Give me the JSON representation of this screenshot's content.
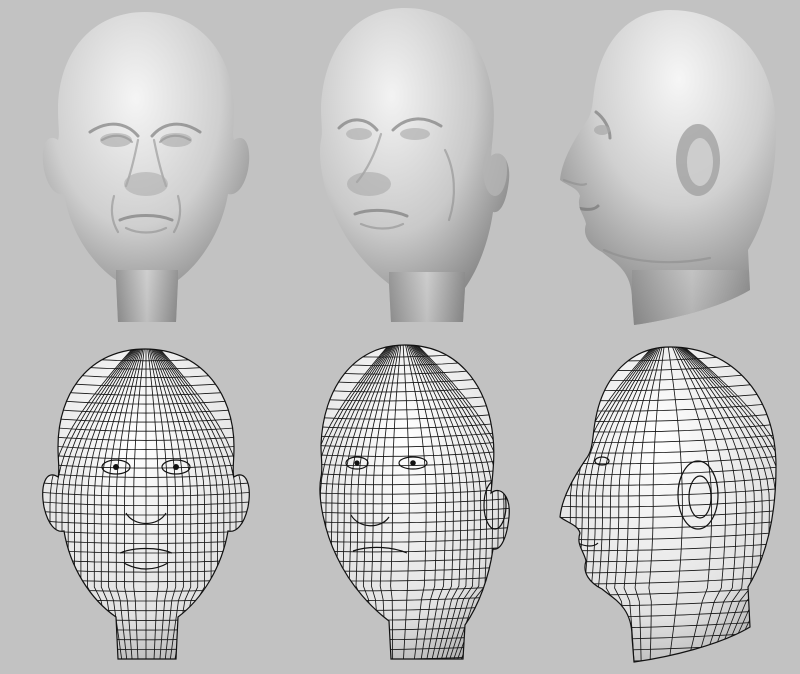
{
  "panels": [
    {
      "row": "shaded",
      "view": "front",
      "icon": "shaded-head-front-icon"
    },
    {
      "row": "shaded",
      "view": "three-quarter",
      "icon": "shaded-head-three-quarter-icon"
    },
    {
      "row": "shaded",
      "view": "side",
      "icon": "shaded-head-side-icon"
    },
    {
      "row": "wireframe",
      "view": "front",
      "icon": "wireframe-head-front-icon"
    },
    {
      "row": "wireframe",
      "view": "three-quarter",
      "icon": "wireframe-head-three-quarter-icon"
    },
    {
      "row": "wireframe",
      "view": "side",
      "icon": "wireframe-head-side-icon"
    }
  ],
  "colors": {
    "background": "#c2c2c2",
    "skin_highlight": "#f4f4f4",
    "skin_mid": "#bdbdbd",
    "skin_shadow": "#7a7a7a",
    "wire": "#151515"
  }
}
